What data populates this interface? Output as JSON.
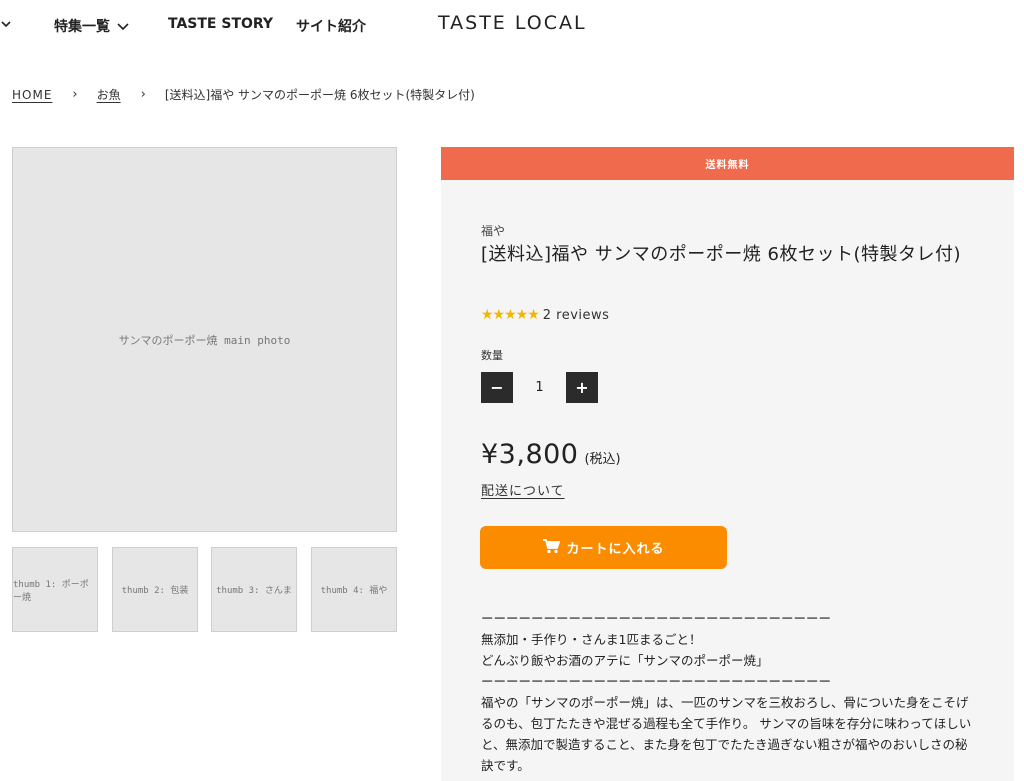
{
  "nav": {
    "feature_label": "特集一覧",
    "story_label": "TASTE STORY",
    "about_label": "サイト紹介",
    "logo": "TASTE LOCAL"
  },
  "breadcrumb": {
    "home": "HOME",
    "sep": "›",
    "category": "お魚",
    "current": "[送料込]福や サンマのポーポー焼 6枚セット(特製タレ付)"
  },
  "gallery": {
    "main_alt": "サンマのポーポー焼 main photo",
    "thumbs": [
      "thumb 1: ポーポー焼",
      "thumb 2: 包装",
      "thumb 3: さんま",
      "thumb 4: 福や"
    ]
  },
  "product": {
    "banner": "送料無料",
    "vendor": "福や",
    "title": "[送料込]福や サンマのポーポー焼 6枚セット(特製タレ付)",
    "stars": "★★★★★",
    "reviews": "2 reviews",
    "qty_label": "数量",
    "qty_minus": "−",
    "qty_value": "1",
    "qty_plus": "+",
    "price": "¥3,800",
    "tax": "(税込)",
    "shipping_link": "配送について",
    "cart_label": "カートに入れる"
  },
  "description": {
    "divider": "ーーーーーーーーーーーーーーーーーーーーーーーーーーーー",
    "line1": "無添加・手作り・さんま1匹まるごと！",
    "line2": "どんぶり飯やお酒のアテに「サンマのポーポー焼」",
    "paragraph": "福やの「サンマのポーポー焼」は、一匹のサンマを三枚おろし、骨についた身をこそげるのも、包丁たたきや混ぜる過程も全て手作り。 サンマの旨味を存分に味わってほしいと、無添加で製造すること、また身を包丁でたたき過ぎない粗さが福やのおいしさの秘訣です。"
  },
  "colors": {
    "banner": "#f06b4e",
    "cart_button": "#fb8c00",
    "stars": "#f2b705",
    "panel_bg": "#f5f5f5"
  }
}
